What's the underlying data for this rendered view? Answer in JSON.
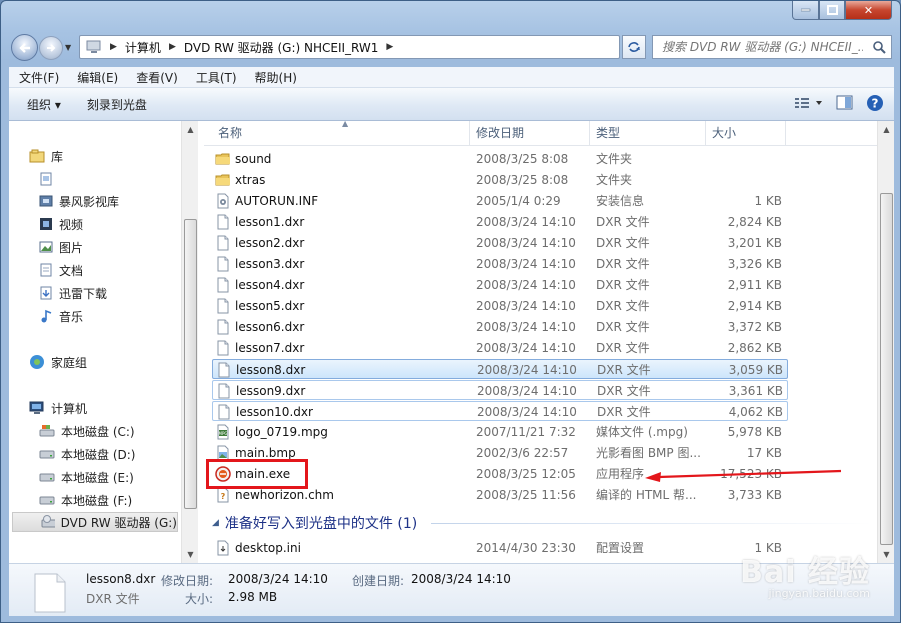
{
  "window": {
    "caption_min": "—",
    "caption_max": "□",
    "caption_close": "✕"
  },
  "address": {
    "crumbs": [
      "计算机",
      "DVD RW 驱动器 (G:) NHCEII_RW1"
    ],
    "search_placeholder": "搜索 DVD RW 驱动器 (G:) NHCEII_..."
  },
  "menubar": {
    "items": [
      "文件(F)",
      "编辑(E)",
      "查看(V)",
      "工具(T)",
      "帮助(H)"
    ]
  },
  "toolbar": {
    "organize": "组织 ▾",
    "burn": "刻录到光盘"
  },
  "nav": {
    "libraries": "库",
    "items": [
      "",
      "暴风影视库",
      "视频",
      "图片",
      "文档",
      "迅雷下载",
      "音乐"
    ],
    "homegroup": "家庭组",
    "computer": "计算机",
    "drives": [
      "本地磁盘 (C:)",
      "本地磁盘 (D:)",
      "本地磁盘 (E:)",
      "本地磁盘 (F:)",
      "DVD RW 驱动器 (G:)"
    ]
  },
  "columns": {
    "name": "名称",
    "date": "修改日期",
    "type": "类型",
    "size": "大小"
  },
  "files": [
    {
      "name": "sound",
      "date": "2008/3/25 8:08",
      "type": "文件夹",
      "size": "",
      "icon": "folder-icon"
    },
    {
      "name": "xtras",
      "date": "2008/3/25 8:08",
      "type": "文件夹",
      "size": "",
      "icon": "folder-icon"
    },
    {
      "name": "AUTORUN.INF",
      "date": "2005/1/4 0:29",
      "type": "安装信息",
      "size": "1 KB",
      "icon": "settings-file-icon"
    },
    {
      "name": "lesson1.dxr",
      "date": "2008/3/24 14:10",
      "type": "DXR 文件",
      "size": "2,824 KB",
      "icon": "blank-file-icon"
    },
    {
      "name": "lesson2.dxr",
      "date": "2008/3/24 14:10",
      "type": "DXR 文件",
      "size": "3,201 KB",
      "icon": "blank-file-icon"
    },
    {
      "name": "lesson3.dxr",
      "date": "2008/3/24 14:10",
      "type": "DXR 文件",
      "size": "3,326 KB",
      "icon": "blank-file-icon"
    },
    {
      "name": "lesson4.dxr",
      "date": "2008/3/24 14:10",
      "type": "DXR 文件",
      "size": "2,911 KB",
      "icon": "blank-file-icon"
    },
    {
      "name": "lesson5.dxr",
      "date": "2008/3/24 14:10",
      "type": "DXR 文件",
      "size": "2,914 KB",
      "icon": "blank-file-icon"
    },
    {
      "name": "lesson6.dxr",
      "date": "2008/3/24 14:10",
      "type": "DXR 文件",
      "size": "3,372 KB",
      "icon": "blank-file-icon"
    },
    {
      "name": "lesson7.dxr",
      "date": "2008/3/24 14:10",
      "type": "DXR 文件",
      "size": "2,862 KB",
      "icon": "blank-file-icon"
    },
    {
      "name": "lesson8.dxr",
      "date": "2008/3/24 14:10",
      "type": "DXR 文件",
      "size": "3,059 KB",
      "icon": "blank-file-icon"
    },
    {
      "name": "lesson9.dxr",
      "date": "2008/3/24 14:10",
      "type": "DXR 文件",
      "size": "3,361 KB",
      "icon": "blank-file-icon"
    },
    {
      "name": "lesson10.dxr",
      "date": "2008/3/24 14:10",
      "type": "DXR 文件",
      "size": "4,062 KB",
      "icon": "blank-file-icon"
    },
    {
      "name": "logo_0719.mpg",
      "date": "2007/11/21 7:32",
      "type": "媒体文件 (.mpg)",
      "size": "5,978 KB",
      "icon": "media-file-icon"
    },
    {
      "name": "main.bmp",
      "date": "2002/3/6 22:57",
      "type": "光影看图 BMP 图...",
      "size": "17 KB",
      "icon": "image-file-icon"
    },
    {
      "name": "main.exe",
      "date": "2008/3/25 12:05",
      "type": "应用程序",
      "size": "17,523 KB",
      "icon": "exe-app-icon"
    },
    {
      "name": "newhorizon.chm",
      "date": "2008/3/25 11:56",
      "type": "编译的 HTML 帮...",
      "size": "3,733 KB",
      "icon": "help-file-icon"
    }
  ],
  "group": {
    "title": "准备好写入到光盘中的文件 (1)",
    "files": [
      {
        "name": "desktop.ini",
        "date": "2014/4/30 23:30",
        "type": "配置设置",
        "size": "1 KB",
        "icon": "ini-file-icon"
      }
    ]
  },
  "details": {
    "name": "lesson8.dxr",
    "type": "DXR 文件",
    "modified_label": "修改日期:",
    "modified_value": "2008/3/24 14:10",
    "created_label": "创建日期:",
    "created_value": "2008/3/24 14:10",
    "size_label": "大小:",
    "size_value": "2.98 MB"
  },
  "watermark": {
    "big": "Bai 经验",
    "small": "jingyan.baidu.com"
  },
  "colors": {
    "accent": "#1e3287",
    "selection": "#cde5fb",
    "annotation": "#e3161b"
  }
}
